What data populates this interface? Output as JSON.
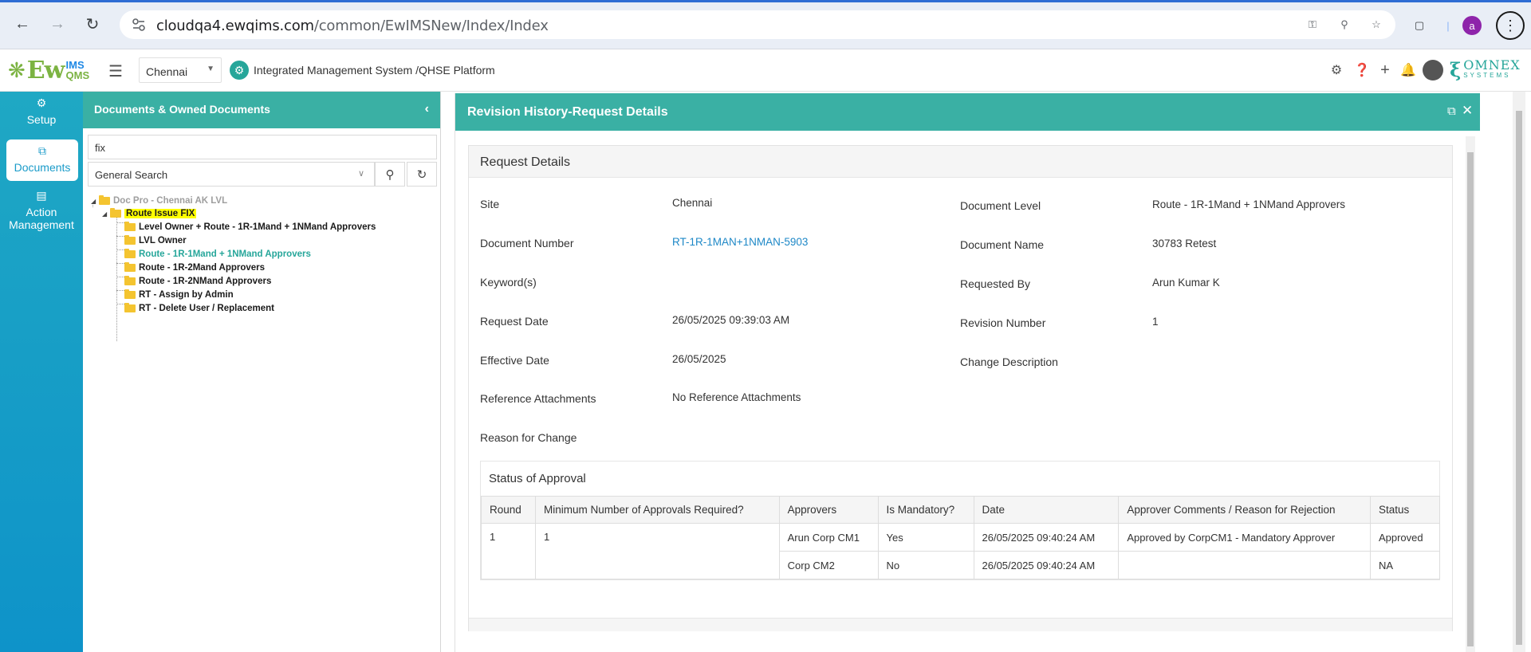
{
  "browser": {
    "url_host": "cloudqa4.ewqims.com",
    "url_path": "/common/EwIMSNew/Index/Index",
    "profile_initial": "a"
  },
  "header": {
    "logo_ew": "Ew",
    "logo_ims": "IMS",
    "logo_qms": "QMS",
    "site": "Chennai",
    "platform_title": "Integrated Management System /QHSE Platform",
    "brand_name": "OMNEX",
    "brand_sub": "SYSTEMS"
  },
  "sidebar": {
    "items": [
      {
        "label": "Setup",
        "icon": "gears-icon"
      },
      {
        "label": "Documents",
        "icon": "documents-icon"
      },
      {
        "label": "Action Management",
        "icon": "clipboard-icon"
      }
    ]
  },
  "doc_panel": {
    "title": "Documents & Owned Documents",
    "search_value": "fix",
    "search_type": "General Search",
    "tree": {
      "root": "Doc Pro - Chennai AK LVL",
      "parent": "Route Issue FIX",
      "children": [
        "Level Owner + Route - 1R-1Mand + 1NMand Approvers",
        "LVL Owner",
        "Route - 1R-1Mand + 1NMand Approvers",
        "Route - 1R-2Mand Approvers",
        "Route - 1R-2NMand Approvers",
        "RT - Assign by Admin",
        "RT - Delete User / Replacement"
      ]
    }
  },
  "modal": {
    "title": "Revision History-Request Details",
    "section_title": "Request Details",
    "fields_left": [
      {
        "label": "Site",
        "value": "Chennai"
      },
      {
        "label": "Document Number",
        "value": "RT-1R-1MAN+1NMAN-5903"
      },
      {
        "label": "Keyword(s)",
        "value": ""
      },
      {
        "label": "Request Date",
        "value": "26/05/2025 09:39:03 AM"
      },
      {
        "label": "Effective Date",
        "value": "26/05/2025"
      },
      {
        "label": "Reference Attachments",
        "value": "No Reference Attachments"
      },
      {
        "label": "Reason for Change",
        "value": ""
      }
    ],
    "fields_right": [
      {
        "label": "Document Level",
        "value": "Route - 1R-1Mand + 1NMand Approvers"
      },
      {
        "label": "Document Name",
        "value": "30783 Retest"
      },
      {
        "label": "Requested By",
        "value": "Arun Kumar K"
      },
      {
        "label": "Revision Number",
        "value": "1"
      },
      {
        "label": "Change Description",
        "value": ""
      }
    ],
    "approval": {
      "title": "Status of Approval",
      "columns": [
        "Round",
        "Minimum Number of Approvals Required?",
        "Approvers",
        "Is Mandatory?",
        "Date",
        "Approver Comments / Reason for Rejection",
        "Status"
      ],
      "round": "1",
      "min_required": "1",
      "rows": [
        {
          "approver": "Arun Corp CM1",
          "mandatory": "Yes",
          "date": "26/05/2025 09:40:24 AM",
          "comments": "Approved by CorpCM1 - Mandatory Approver",
          "status": "Approved"
        },
        {
          "approver": "Corp CM2",
          "mandatory": "No",
          "date": "26/05/2025 09:40:24 AM",
          "comments": "",
          "status": "NA"
        }
      ]
    }
  },
  "colors": {
    "teal": "#3ab0a4",
    "sidebar": "#0e93c9",
    "link": "#1e88c7",
    "highlight": "#ffff00"
  }
}
